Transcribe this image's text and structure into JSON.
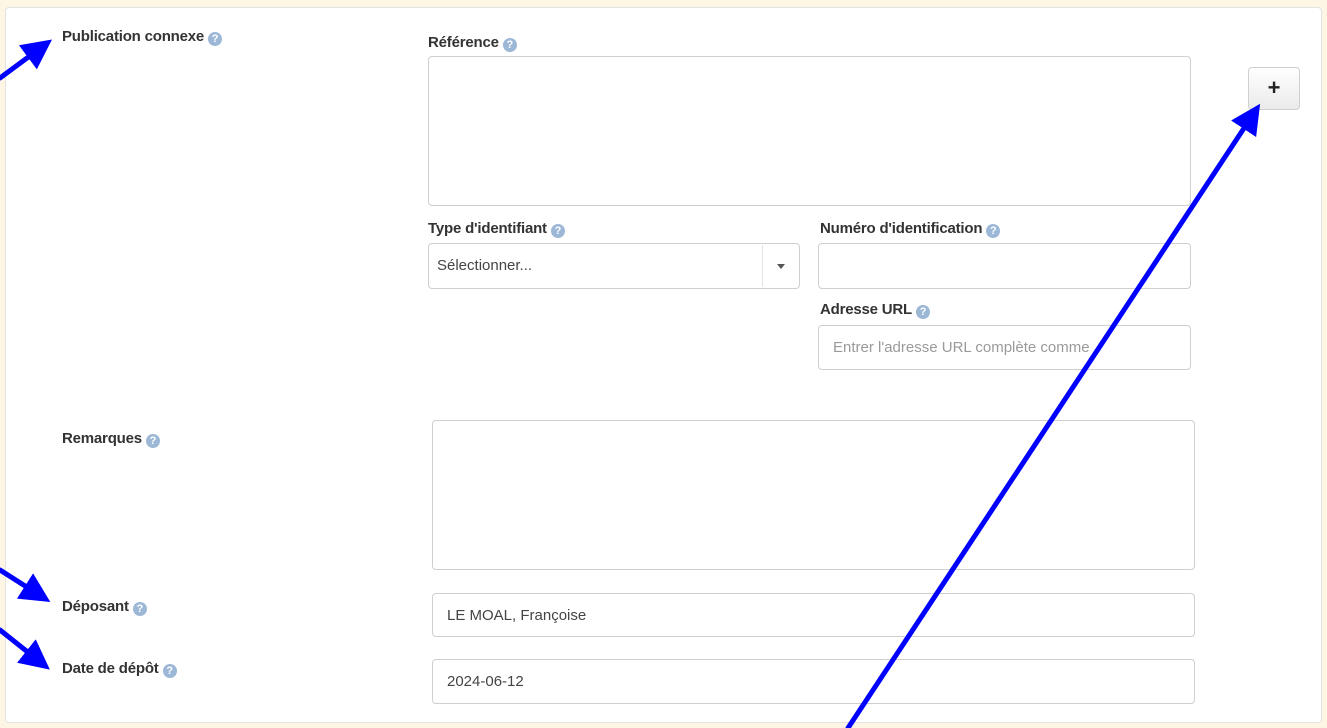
{
  "related_publication": {
    "label": "Publication connexe",
    "reference_label": "Référence",
    "reference_value": "",
    "identifier_type_label": "Type d'identifiant",
    "identifier_type_selected": "Sélectionner...",
    "identification_number_label": "Numéro d'identification",
    "identification_number_value": "",
    "url_label": "Adresse URL",
    "url_placeholder": "Entrer l'adresse URL complète comme",
    "add_button": "+"
  },
  "remarks": {
    "label": "Remarques",
    "value": ""
  },
  "depositor": {
    "label": "Déposant",
    "value": "LE MOAL, Françoise"
  },
  "deposit_date": {
    "label": "Date de dépôt",
    "value": "2024-06-12"
  },
  "help_icon_glyph": "?",
  "colors": {
    "background": "#fdf6e4",
    "annotation_arrow": "#0000ff",
    "help_icon": "#9cb8d6"
  }
}
